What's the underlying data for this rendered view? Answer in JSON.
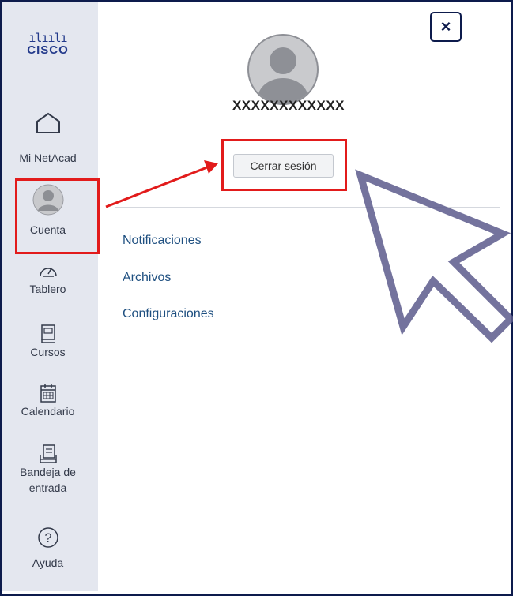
{
  "brand": {
    "logo_bars": "ılıılı",
    "logo_word": "CISCO"
  },
  "sidebar": {
    "items": [
      {
        "label": "Mi NetAcad",
        "icon": "home-icon"
      },
      {
        "label": "Cuenta",
        "icon": "user-avatar-icon"
      },
      {
        "label": "Tablero",
        "icon": "dashboard-gauge-icon"
      },
      {
        "label": "Cursos",
        "icon": "courses-book-icon"
      },
      {
        "label": "Calendario",
        "icon": "calendar-icon"
      },
      {
        "label_line1": "Bandeja de",
        "label_line2": "entrada",
        "icon": "inbox-icon"
      },
      {
        "label": "Ayuda",
        "icon": "help-question-icon"
      }
    ]
  },
  "account_panel": {
    "close_label": "×",
    "username": "XXXXXXXXXXXX",
    "logout_label": "Cerrar sesión",
    "links": [
      "Notificaciones",
      "Archivos",
      "Configuraciones"
    ]
  },
  "colors": {
    "frame": "#0d1b4c",
    "sidebar_bg": "#e4e7ef",
    "highlight": "#e21b1b",
    "link": "#1e4f80",
    "cursor_outline": "#5c5a8c"
  }
}
